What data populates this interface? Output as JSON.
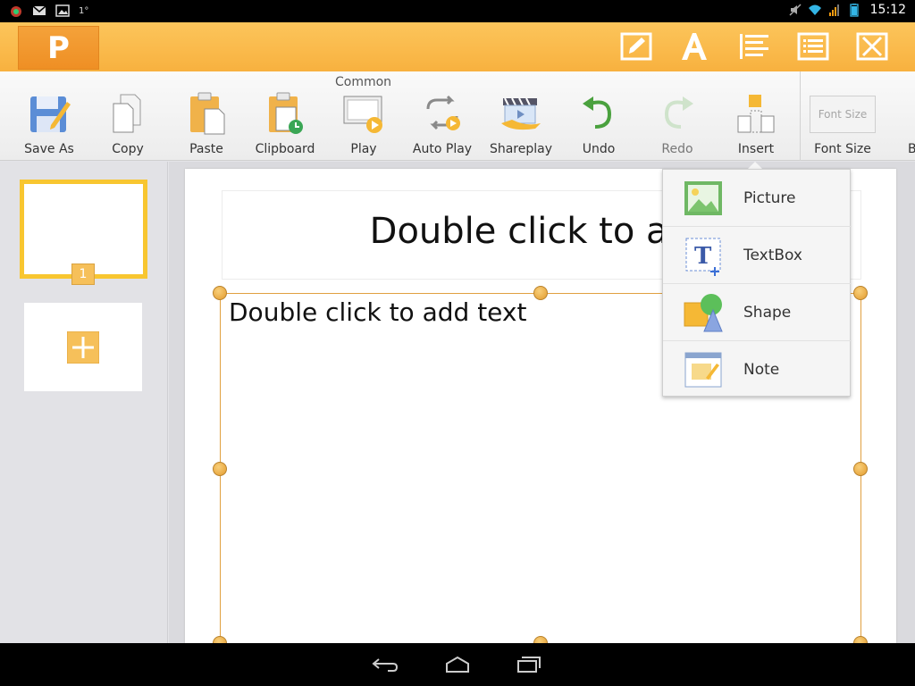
{
  "status_bar": {
    "clock": "15:12",
    "small_indicator": "1°",
    "left_icons": [
      "app-notification-icon",
      "gmail-icon",
      "image-notification-icon"
    ],
    "right_icons": [
      "mute-icon",
      "wifi-icon",
      "signal-icon",
      "battery-icon"
    ]
  },
  "header": {
    "logo_letter": "P",
    "buttons": [
      "edit-icon",
      "text-format-icon",
      "align-icon",
      "list-icon",
      "close-icon"
    ]
  },
  "ribbon": {
    "group_label": "Common",
    "items": [
      {
        "label": "Save As",
        "icon": "save-as-icon"
      },
      {
        "label": "Copy",
        "icon": "copy-icon"
      },
      {
        "label": "Paste",
        "icon": "paste-icon"
      },
      {
        "label": "Clipboard",
        "icon": "clipboard-icon"
      },
      {
        "label": "Play",
        "icon": "play-icon"
      },
      {
        "label": "Auto Play",
        "icon": "auto-play-icon"
      },
      {
        "label": "Shareplay",
        "icon": "shareplay-icon"
      },
      {
        "label": "Undo",
        "icon": "undo-icon"
      },
      {
        "label": "Redo",
        "icon": "redo-icon"
      },
      {
        "label": "Insert",
        "icon": "insert-icon"
      }
    ],
    "font_size": {
      "box_text": "Font Size",
      "label": "Font Size"
    },
    "next_partial": "B"
  },
  "slides": {
    "thumb_number": "1"
  },
  "slide": {
    "title_placeholder": "Double click to add title",
    "title_visible": "Double click to add",
    "body_placeholder": "Double click to add text"
  },
  "insert_menu": {
    "items": [
      {
        "label": "Picture",
        "icon": "picture-icon"
      },
      {
        "label": "TextBox",
        "icon": "textbox-icon"
      },
      {
        "label": "Shape",
        "icon": "shape-icon"
      },
      {
        "label": "Note",
        "icon": "note-icon"
      }
    ]
  },
  "colors": {
    "accent": "#f8b13f",
    "selection": "#f8c630"
  }
}
